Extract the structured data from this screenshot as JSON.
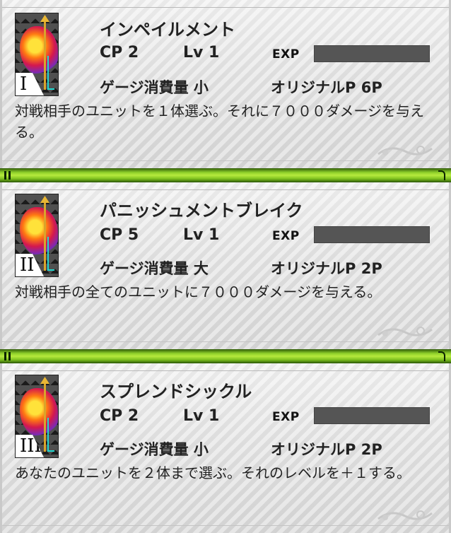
{
  "skills": [
    {
      "numeral": "I",
      "name": "インペイルメント",
      "cp": "CP 2",
      "lv": "Lv 1",
      "exp_label": "EXP",
      "gauge": "ゲージ消費量 小",
      "original": "オリジナルP 6P",
      "description": "対戦相手のユニットを１体選ぶ。それに７０００ダメージを与える。"
    },
    {
      "numeral": "II",
      "name": "パニッシュメントブレイク",
      "cp": "CP 5",
      "lv": "Lv 1",
      "exp_label": "EXP",
      "gauge": "ゲージ消費量 大",
      "original": "オリジナルP 2P",
      "description": "対戦相手の全てのユニットに７０００ダメージを与える。"
    },
    {
      "numeral": "III",
      "name": "スプレンドシックル",
      "cp": "CP 2",
      "lv": "Lv 1",
      "exp_label": "EXP",
      "gauge": "ゲージ消費量 小",
      "original": "オリジナルP 2P",
      "description": "あなたのユニットを２体まで選ぶ。それのレベルを＋１する。"
    }
  ]
}
